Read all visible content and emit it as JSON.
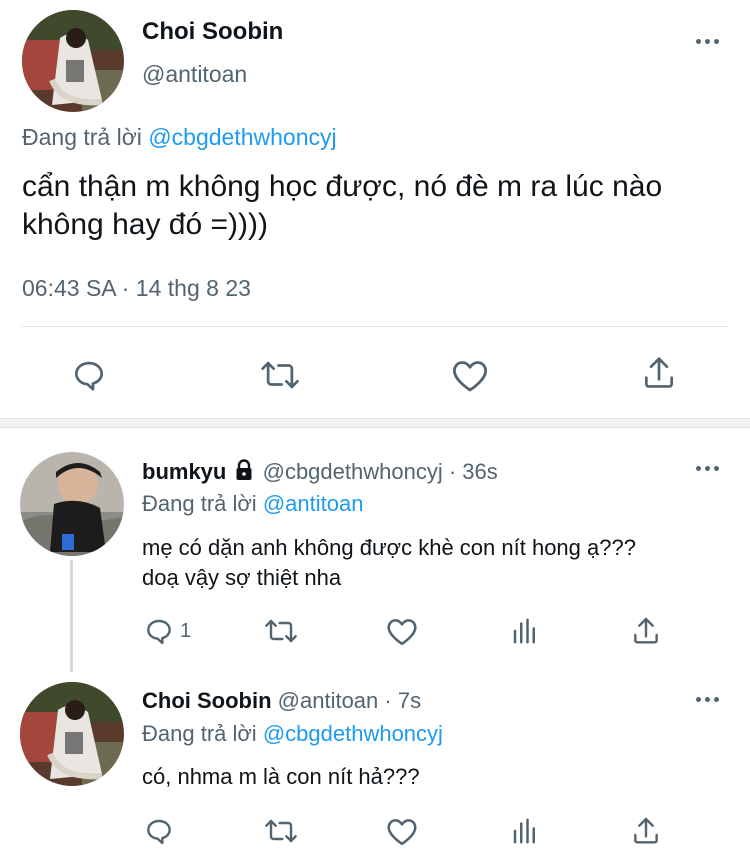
{
  "main_tweet": {
    "display_name": "Choi Soobin",
    "handle": "@antitoan",
    "reply_prefix": "Đang trả lời",
    "reply_to": "@cbgdethwhoncyj",
    "text_line1": "cẩn thận m không học được, nó đè m ra lúc nào",
    "text_line2": "không hay đó =))))",
    "timestamp": "06:43 SA · 14 thg 8 23"
  },
  "replies": [
    {
      "display_name": "bumkyu",
      "handle": "@cbgdethwhoncyj · 36s",
      "reply_prefix": "Đang trả lời",
      "reply_to": "@antitoan",
      "text_line1": "mẹ có dặn anh không được khè con nít hong ạ???",
      "text_line2": "doạ vậy sợ thiệt nha",
      "reply_count": "1"
    },
    {
      "display_name": "Choi Soobin",
      "handle": "@antitoan · 7s",
      "reply_prefix": "Đang trả lời",
      "reply_to": "@cbgdethwhoncyj",
      "text_line1": "có, nhma m là con nít hả???"
    }
  ],
  "icons": {
    "reply": "reply-icon",
    "retweet": "retweet-icon",
    "like": "heart-icon",
    "share": "share-icon",
    "analytics": "analytics-icon",
    "lock": "lock-icon",
    "more": "more-icon"
  },
  "colors": {
    "link": "#1d9bf0",
    "muted": "#536471",
    "text": "#0f1419"
  }
}
